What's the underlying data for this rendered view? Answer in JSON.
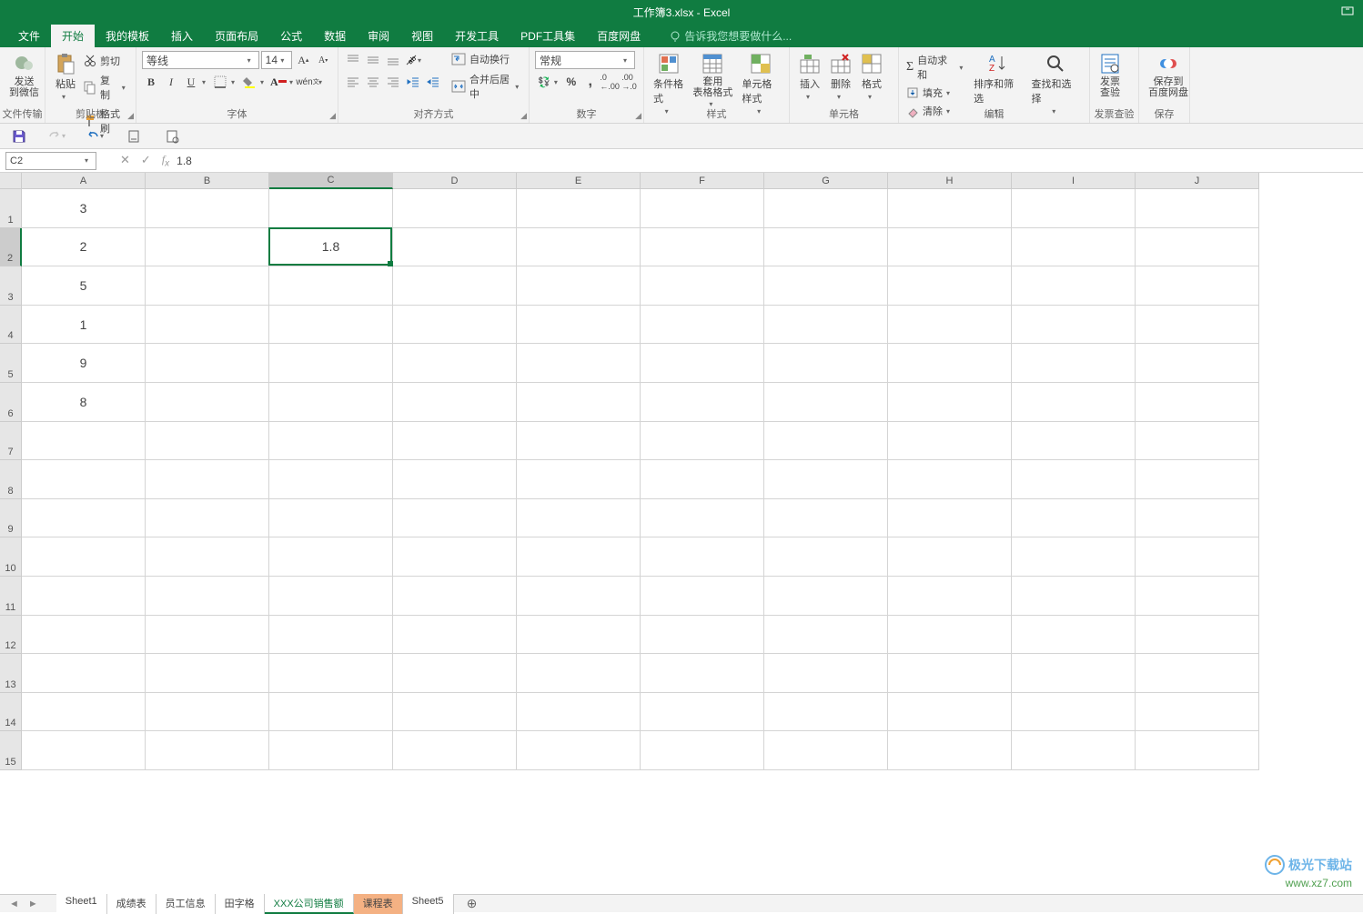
{
  "title": "工作簿3.xlsx - Excel",
  "tabs": [
    "文件",
    "开始",
    "我的模板",
    "插入",
    "页面布局",
    "公式",
    "数据",
    "审阅",
    "视图",
    "开发工具",
    "PDF工具集",
    "百度网盘"
  ],
  "active_tab": 1,
  "tellme": "告诉我您想要做什么...",
  "ribbon": {
    "g0": {
      "label": "文件传输",
      "send": "发送\n到微信"
    },
    "g1": {
      "label": "剪贴板",
      "paste": "粘贴",
      "cut": "剪切",
      "copy": "复制",
      "painter": "格式刷"
    },
    "g2": {
      "label": "字体",
      "font": "等线",
      "size": "14"
    },
    "g3": {
      "label": "对齐方式",
      "wrap": "自动换行",
      "merge": "合并后居中"
    },
    "g4": {
      "label": "数字",
      "format": "常规"
    },
    "g5": {
      "label": "样式",
      "cond": "条件格式",
      "table": "套用\n表格格式",
      "cell": "单元格样式"
    },
    "g6": {
      "label": "单元格",
      "insert": "插入",
      "delete": "删除",
      "format": "格式"
    },
    "g7": {
      "label": "编辑",
      "sum": "自动求和",
      "fill": "填充",
      "clear": "清除",
      "sort": "排序和筛选",
      "find": "查找和选择"
    },
    "g8": {
      "label": "发票查验",
      "inv": "发票\n查验"
    },
    "g9": {
      "label": "保存",
      "save": "保存到\n百度网盘"
    }
  },
  "namebox": "C2",
  "formula": "1.8",
  "columns": [
    "A",
    "B",
    "C",
    "D",
    "E",
    "F",
    "G",
    "H",
    "I",
    "J"
  ],
  "rows": [
    "1",
    "2",
    "3",
    "4",
    "5",
    "6",
    "7",
    "8",
    "9",
    "10",
    "11",
    "12",
    "13",
    "14",
    "15"
  ],
  "cells": {
    "A1": "3",
    "A2": "2",
    "A3": "5",
    "A4": "1",
    "A5": "9",
    "A6": "8",
    "C2": "1.8"
  },
  "selected": {
    "col": 2,
    "row": 1
  },
  "sheets": [
    "Sheet1",
    "成绩表",
    "员工信息",
    "田字格",
    "XXX公司销售额",
    "课程表",
    "Sheet5"
  ],
  "active_sheet": 4,
  "highlight_sheet": 5,
  "watermark": {
    "l1": "极光下载站",
    "l2": "www.xz7.com"
  }
}
